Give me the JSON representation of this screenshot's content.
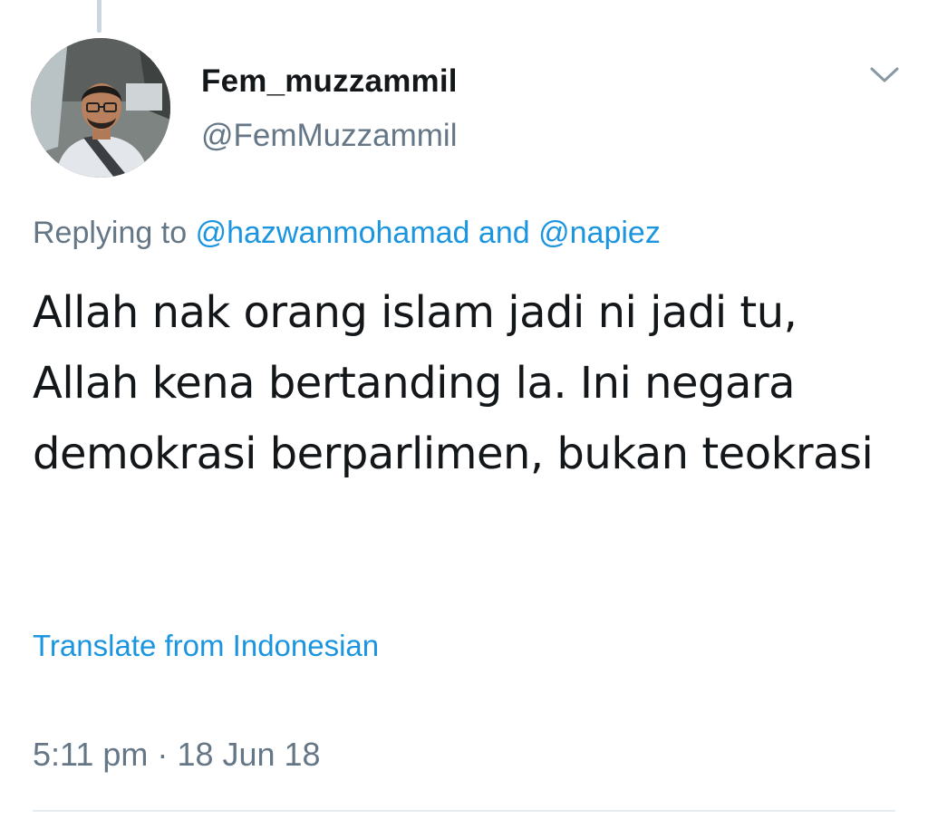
{
  "tweet": {
    "author": {
      "display_name": "Fem_muzzammil",
      "handle": "@FemMuzzammil",
      "avatar_icon": "user-avatar-photo"
    },
    "menu_icon": "chevron-down-icon",
    "reply": {
      "prefix": "Replying to",
      "mention_1": "@hazwanmohamad",
      "joiner": "and",
      "mention_2": "@napiez"
    },
    "text": "Allah nak orang islam jadi ni jadi tu, Allah kena bertanding la. Ini negara demokrasi berparlimen, bukan teokrasi",
    "translate_label": "Translate from Indonesian",
    "timestamp": {
      "time": "5:11 pm",
      "separator": "·",
      "date": "18 Jun 18"
    }
  },
  "colors": {
    "text_primary": "#14171a",
    "text_secondary": "#657786",
    "link": "#1b95e0",
    "divider": "#e6ecf0"
  }
}
